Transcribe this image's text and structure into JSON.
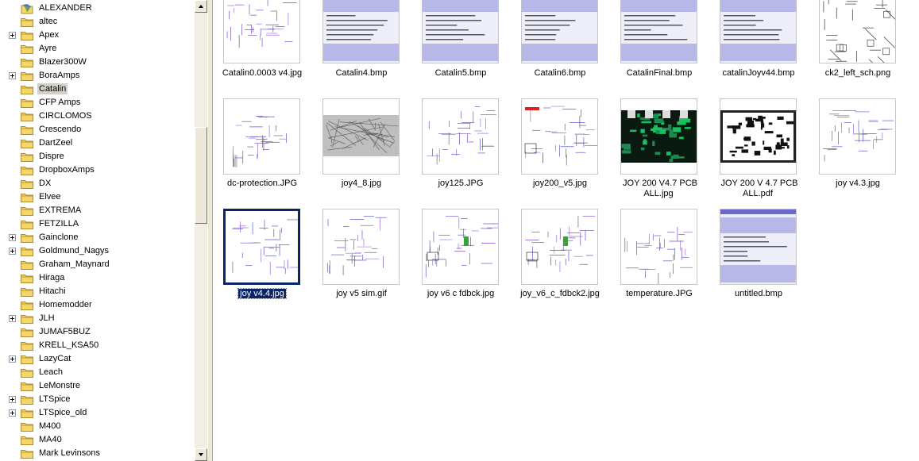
{
  "tree": {
    "items": [
      {
        "label": "ALEXANDER",
        "expander": false,
        "special": true
      },
      {
        "label": "altec",
        "expander": false
      },
      {
        "label": "Apex",
        "expander": true
      },
      {
        "label": "Ayre",
        "expander": false
      },
      {
        "label": "Blazer300W",
        "expander": false
      },
      {
        "label": "BoraAmps",
        "expander": true
      },
      {
        "label": "Catalin",
        "expander": false,
        "selected": true
      },
      {
        "label": "CFP Amps",
        "expander": false
      },
      {
        "label": "CIRCLOMOS",
        "expander": false
      },
      {
        "label": "Crescendo",
        "expander": false
      },
      {
        "label": "DartZeel",
        "expander": false
      },
      {
        "label": "Dispre",
        "expander": false
      },
      {
        "label": "DropboxAmps",
        "expander": false
      },
      {
        "label": "DX",
        "expander": false
      },
      {
        "label": "Elvee",
        "expander": false
      },
      {
        "label": "EXTREMA",
        "expander": false
      },
      {
        "label": "FETZILLA",
        "expander": false
      },
      {
        "label": "Gainclone",
        "expander": true
      },
      {
        "label": "Goldmund_Nagys",
        "expander": true
      },
      {
        "label": "Graham_Maynard",
        "expander": false
      },
      {
        "label": "Hiraga",
        "expander": false
      },
      {
        "label": "Hitachi",
        "expander": false
      },
      {
        "label": "Homemodder",
        "expander": false
      },
      {
        "label": "JLH",
        "expander": true
      },
      {
        "label": "JUMAF5BUZ",
        "expander": false
      },
      {
        "label": "KRELL_KSA50",
        "expander": false
      },
      {
        "label": "LazyCat",
        "expander": true
      },
      {
        "label": "Leach",
        "expander": false
      },
      {
        "label": "LeMonstre",
        "expander": false
      },
      {
        "label": "LTSpice",
        "expander": true
      },
      {
        "label": "LTSpice_old",
        "expander": true
      },
      {
        "label": "M400",
        "expander": false
      },
      {
        "label": "MA40",
        "expander": false
      },
      {
        "label": "Mark Levinsons",
        "expander": false
      }
    ]
  },
  "files": [
    {
      "name": "Catalin0.0003 v4.jpg",
      "kind": "schematic"
    },
    {
      "name": "Catalin4.bmp",
      "kind": "sim-window"
    },
    {
      "name": "Catalin5.bmp",
      "kind": "sim-window"
    },
    {
      "name": "Catalin6.bmp",
      "kind": "sim-window"
    },
    {
      "name": "CatalinFinal.bmp",
      "kind": "sim-window"
    },
    {
      "name": "catalinJoyv44.bmp",
      "kind": "sim-window"
    },
    {
      "name": "ck2_left_sch.png",
      "kind": "bw-schematic"
    },
    {
      "name": "dc-protection.JPG",
      "kind": "schematic-small"
    },
    {
      "name": "joy4_8.jpg",
      "kind": "gray-schematic"
    },
    {
      "name": "joy125.JPG",
      "kind": "schematic"
    },
    {
      "name": "joy200_v5.jpg",
      "kind": "schematic-red"
    },
    {
      "name": "JOY 200 V4.7 PCB ALL.jpg",
      "kind": "pcb-green"
    },
    {
      "name": "JOY 200 V 4.7 PCB ALL.pdf",
      "kind": "pcb-bw"
    },
    {
      "name": "joy v4.3.jpg",
      "kind": "schematic"
    },
    {
      "name": "joy v4.4.jpg",
      "kind": "schematic",
      "selected": true
    },
    {
      "name": "joy v5 sim.gif",
      "kind": "schematic"
    },
    {
      "name": "joy v6 c fdbck.jpg",
      "kind": "schematic-green"
    },
    {
      "name": "joy_v6_c_fdbck2.jpg",
      "kind": "schematic-green"
    },
    {
      "name": "temperature.JPG",
      "kind": "schematic-small"
    },
    {
      "name": "untitled.bmp",
      "kind": "sim-window"
    }
  ],
  "colors": {
    "selection": "#0a246a",
    "folder": "#f5d66a",
    "folder_edge": "#b08d2a",
    "sim_band": "#b8b8e8"
  },
  "icons": {
    "folder": "folder-icon",
    "special": "my-pictures-folder-icon",
    "expander": "plus-box-icon"
  }
}
